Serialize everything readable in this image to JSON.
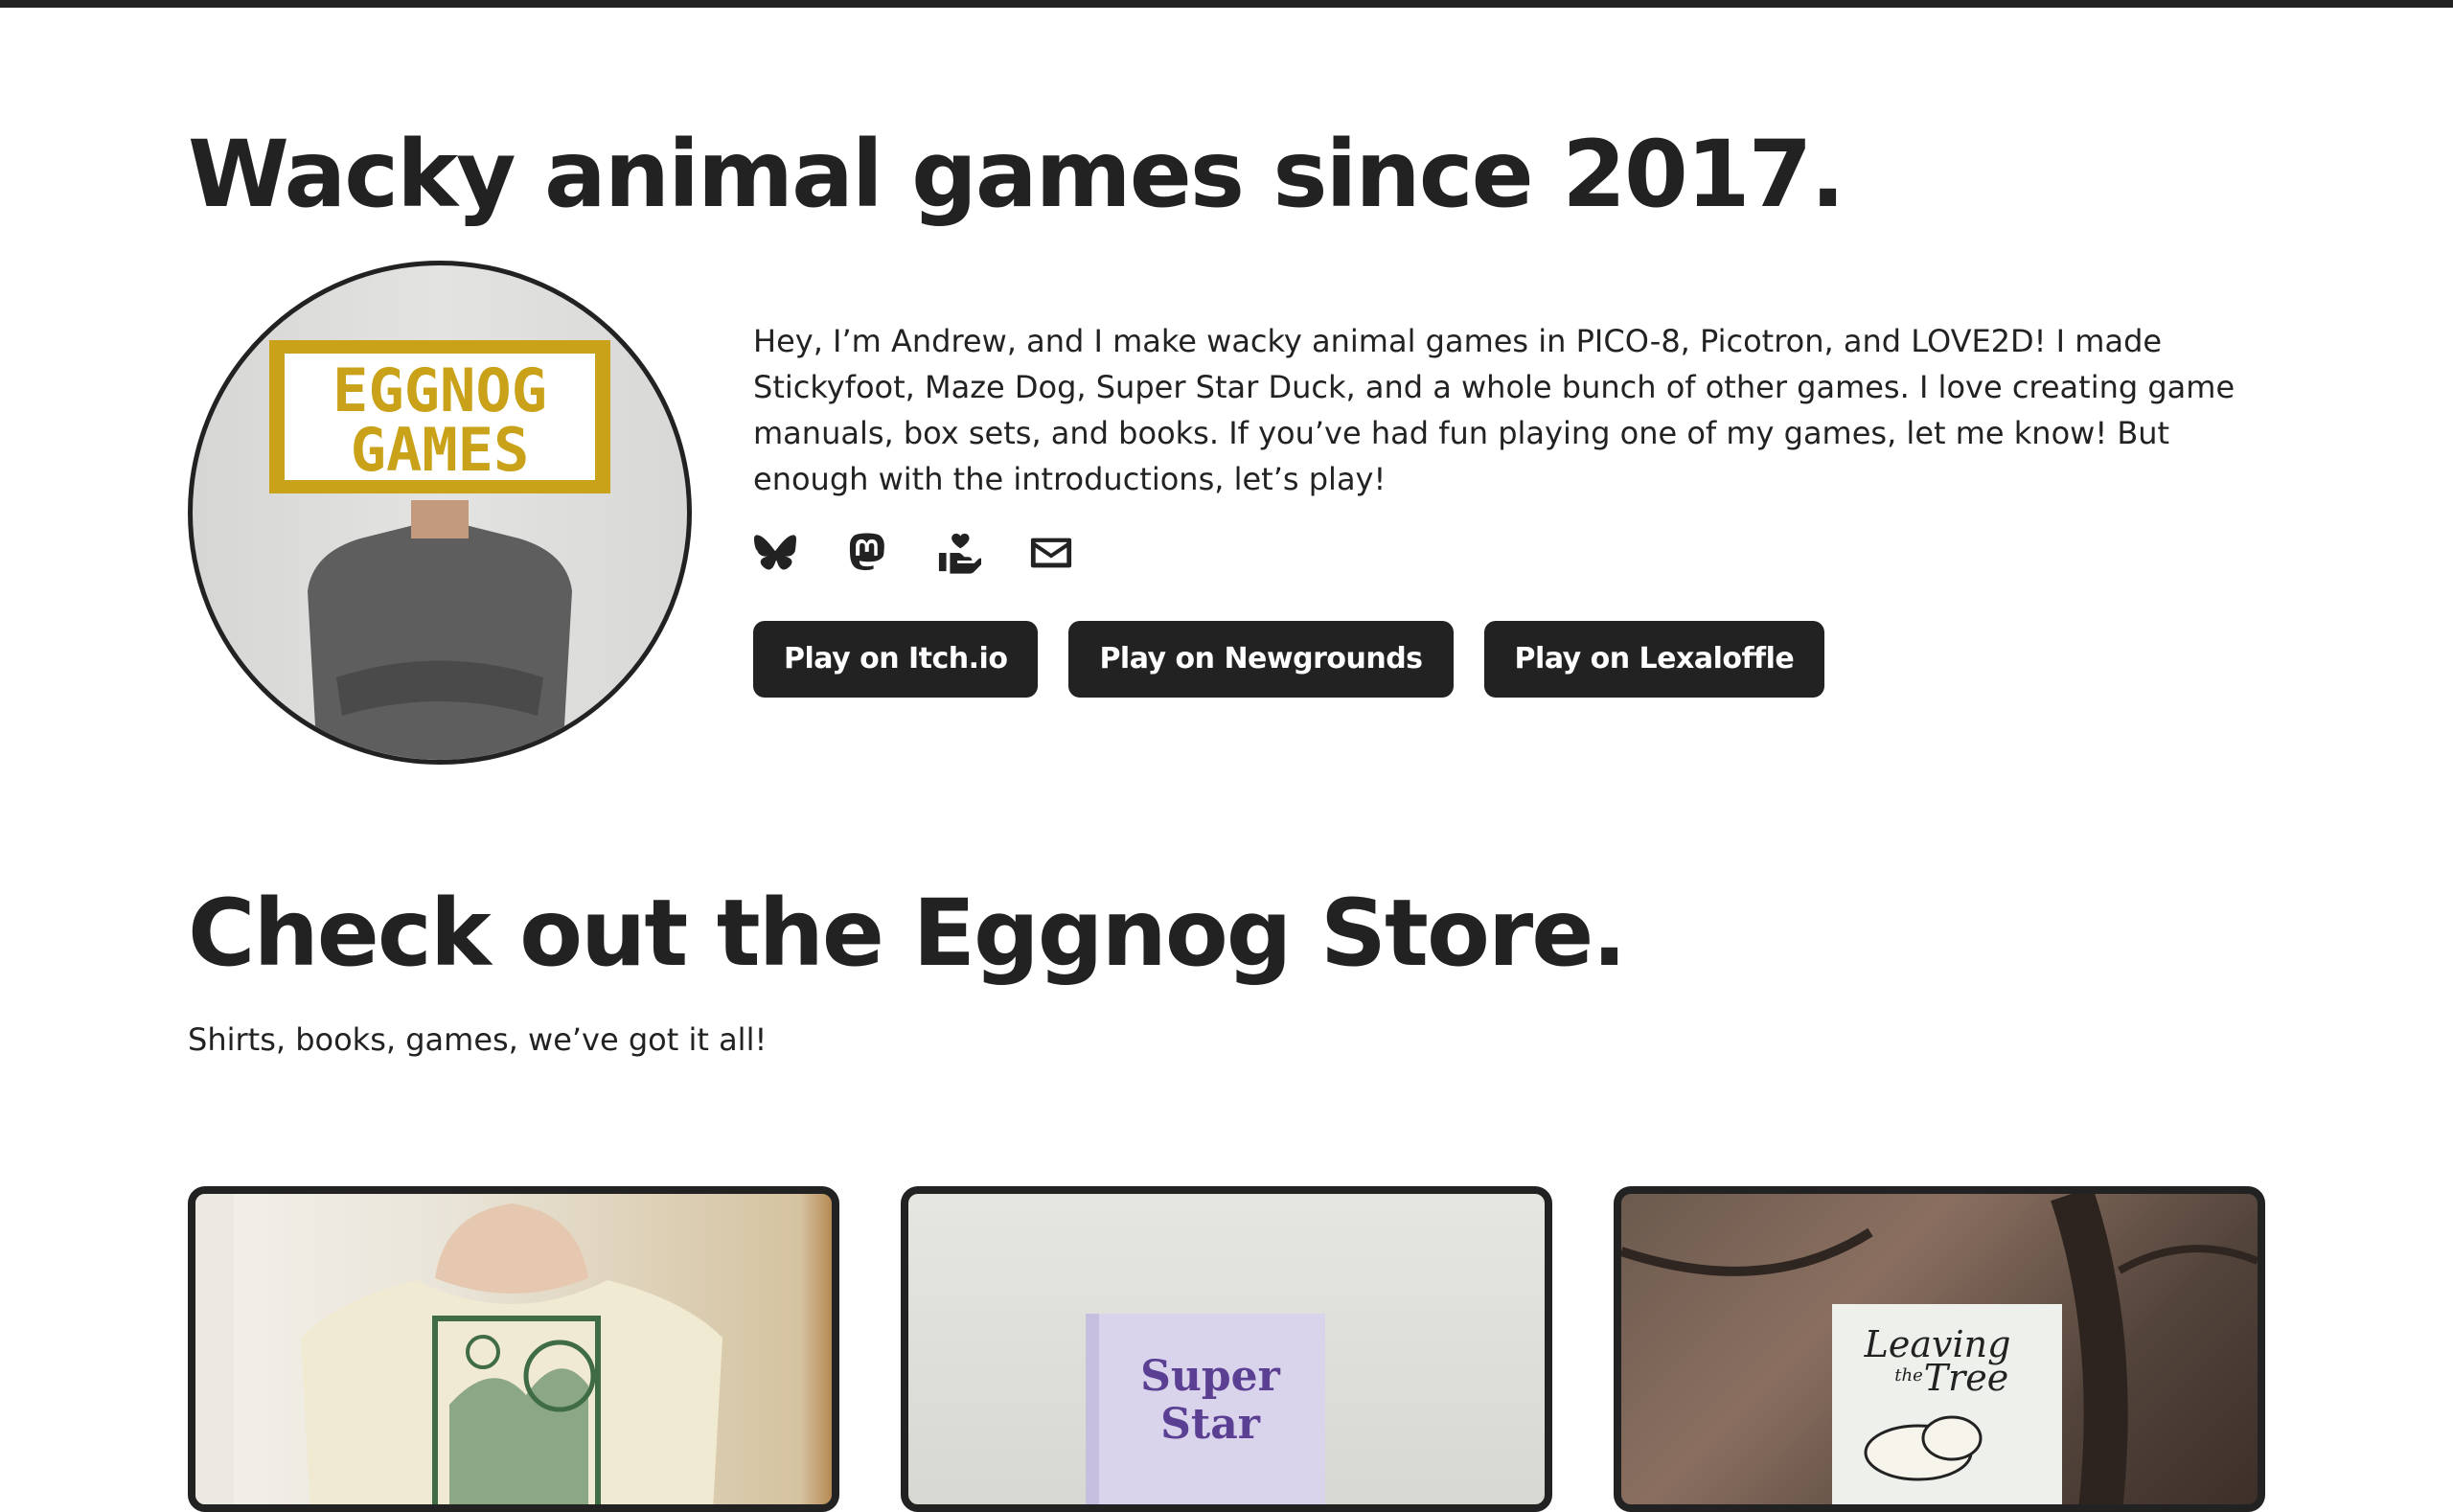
{
  "hero": {
    "title": "Wacky animal games since 2017.",
    "avatar_sign_line1": "EGGNOG",
    "avatar_sign_line2": "GAMES",
    "intro": "Hey, I’m Andrew, and I make wacky animal games in PICO-8, Picotron, and LOVE2D! I made Stickyfoot, Maze Dog, Super Star Duck, and a whole bunch of other games. I love creating game manuals, box sets, and books. If you’ve had fun playing one of my games, let me know! But enough with the introductions, let’s play!",
    "socials": [
      "butterfly-icon",
      "mastodon-icon",
      "donate-icon",
      "email-icon"
    ],
    "buttons": {
      "itch": "Play on Itch.io",
      "newgrounds": "Play on Newgrounds",
      "lexaloffle": "Play on Lexaloffle"
    }
  },
  "store": {
    "title": "Check out the Eggnog Store.",
    "subtitle": "Shirts, books, games, we’ve got it all!",
    "cards": {
      "book1_line1": "Super",
      "book1_line2": "Star",
      "book2_line1": "Leaving",
      "book2_line2": "the",
      "book2_line3": "Tree"
    }
  },
  "colors": {
    "text": "#222222",
    "background": "#ffffff",
    "button_bg": "#222222",
    "button_text": "#ffffff",
    "sign_yellow": "#c9a21a"
  }
}
